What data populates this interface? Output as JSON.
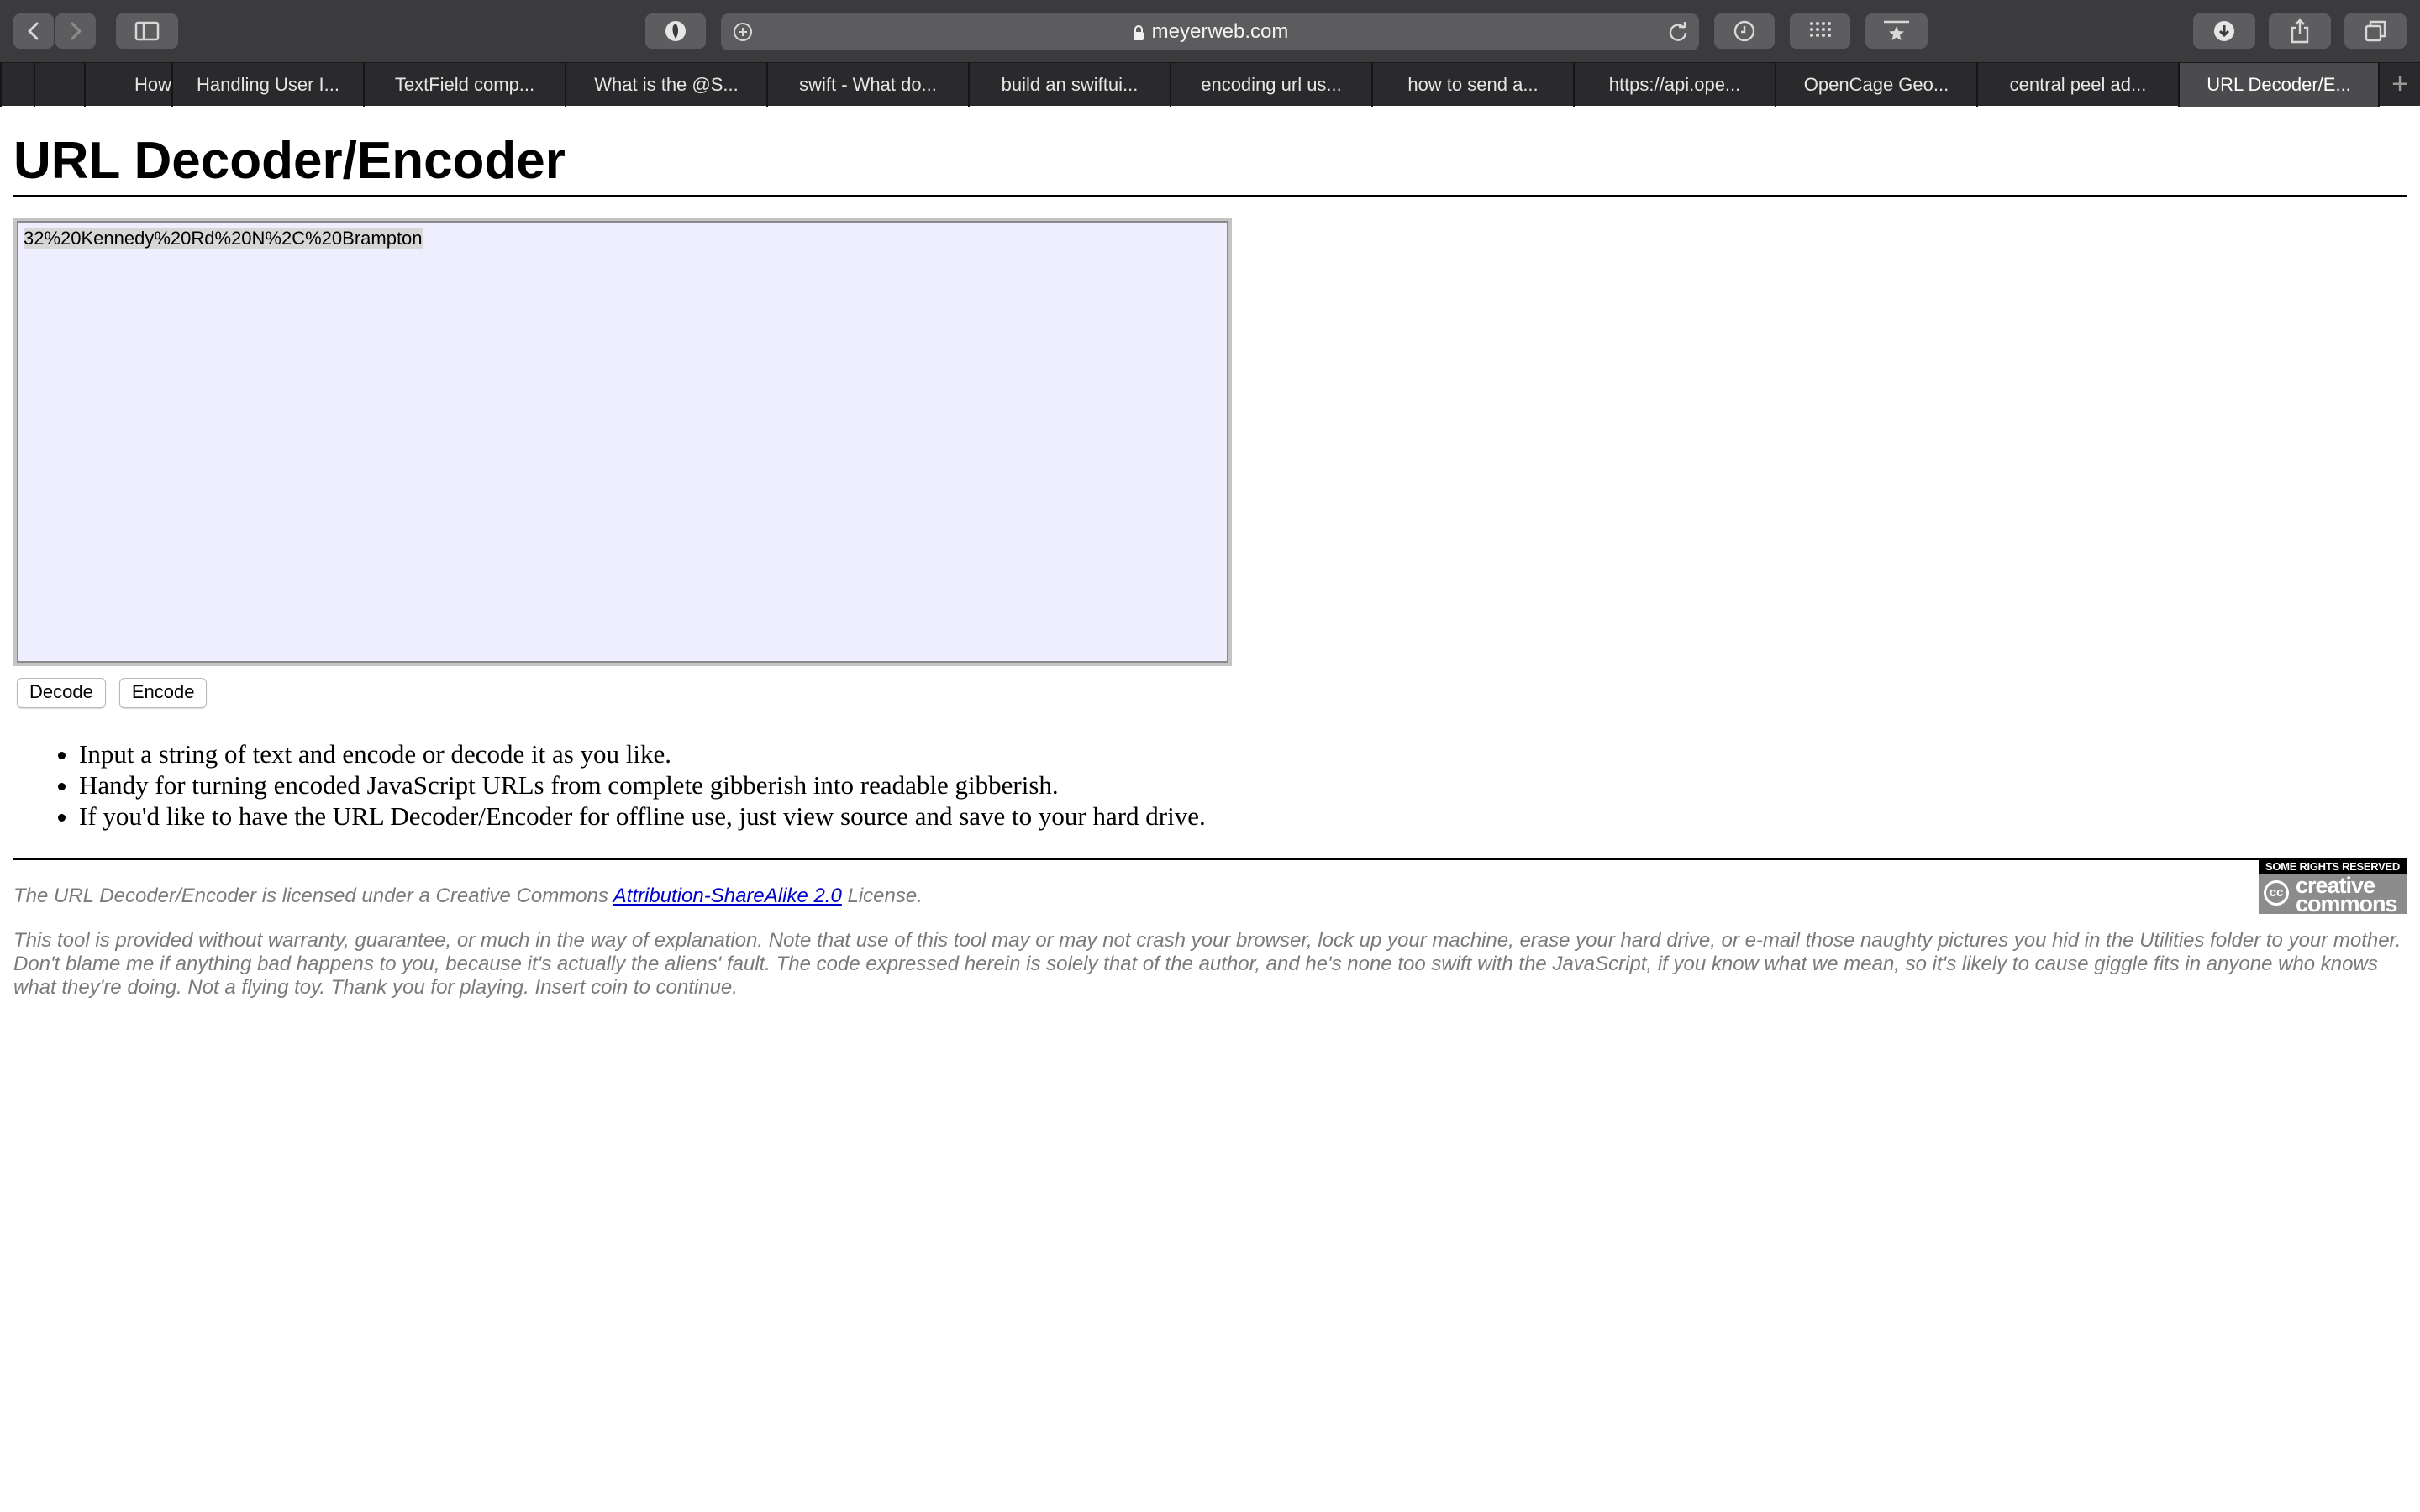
{
  "browser": {
    "address": "meyerweb.com",
    "tabs": [
      {
        "label": "How"
      },
      {
        "label": "Handling User I..."
      },
      {
        "label": "TextField comp..."
      },
      {
        "label": "What is the @S..."
      },
      {
        "label": "swift - What do..."
      },
      {
        "label": "build an swiftui..."
      },
      {
        "label": "encoding url us..."
      },
      {
        "label": "how to send a..."
      },
      {
        "label": "https://api.ope..."
      },
      {
        "label": "OpenCage Geo..."
      },
      {
        "label": "central peel ad..."
      },
      {
        "label": "URL Decoder/E..."
      }
    ],
    "active_tab": "URL Decoder/E...",
    "new_tab_symbol": "+"
  },
  "page": {
    "title": "URL Decoder/Encoder",
    "textarea_value": "32%20Kennedy%20Rd%20N%2C%20Brampton",
    "decode_label": "Decode",
    "encode_label": "Encode",
    "notes": [
      "Input a string of text and encode or decode it as you like.",
      "Handy for turning encoded JavaScript URLs from complete gibberish into readable gibberish.",
      "If you'd like to have the URL Decoder/Encoder for offline use, just view source and save to your hard drive."
    ],
    "license_prefix": "The URL Decoder/Encoder is licensed under a Creative Commons ",
    "license_link": "Attribution-ShareAlike 2.0",
    "license_suffix": " License.",
    "disclaimer": "This tool is provided without warranty, guarantee, or much in the way of explanation. Note that use of this tool may or may not crash your browser, lock up your machine, erase your hard drive, or e-mail those naughty pictures you hid in the Utilities folder to your mother. Don't blame me if anything bad happens to you, because it's actually the aliens' fault. The code expressed herein is solely that of the author, and he's none too swift with the JavaScript, if you know what we mean, so it's likely to cause giggle fits in anyone who knows what they're doing. Not a flying toy. Thank you for playing. Insert coin to continue.",
    "cc_badge_top": "SOME RIGHTS RESERVED",
    "cc_badge_logo": "cc",
    "cc_badge_name": "creative commons"
  },
  "colors": {
    "toolbar": "#3b3b3d",
    "tabbar": "#2a2a2c",
    "active_tab": "#4b4b4e",
    "textarea_bg": "#eeeeff",
    "link": "#0000cc",
    "muted_text": "#7a7a7a"
  },
  "icons": [
    "back-icon",
    "forward-icon",
    "sidebar-icon",
    "shield-icon",
    "add-icon",
    "lock-icon",
    "reload-icon",
    "history-icon",
    "grid-icon",
    "bookmark-star-icon",
    "download-icon",
    "share-icon",
    "tabs-overview-icon"
  ]
}
